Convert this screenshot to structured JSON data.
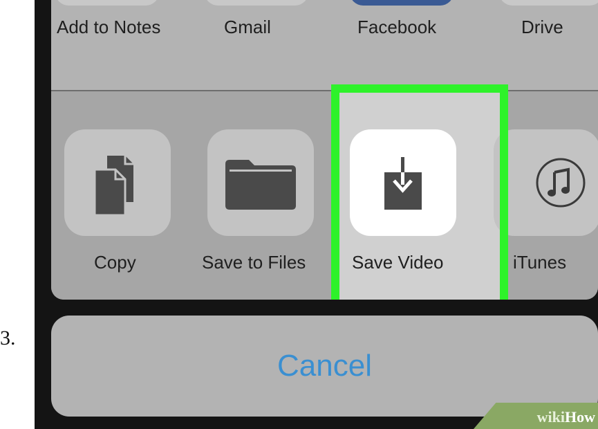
{
  "step_number": "3.",
  "share_sheet": {
    "apps": [
      {
        "label": "Add to Notes"
      },
      {
        "label": "Gmail"
      },
      {
        "label": "Facebook"
      },
      {
        "label": "Drive"
      }
    ],
    "actions": [
      {
        "label": "Copy",
        "icon": "copy-icon"
      },
      {
        "label": "Save to Files",
        "icon": "folder-icon"
      },
      {
        "label": "Save Video",
        "icon": "save-video-icon",
        "highlighted": true
      },
      {
        "label": "iTunes",
        "icon": "music-note-icon"
      }
    ]
  },
  "cancel_button": {
    "label": "Cancel"
  },
  "watermark": {
    "part1": "wiki",
    "part2": "How"
  },
  "colors": {
    "highlight": "#2ef22a",
    "cancel_text": "#3a8fd1",
    "sheet": "#a9a9a9",
    "tile": "#c3c3c3"
  }
}
